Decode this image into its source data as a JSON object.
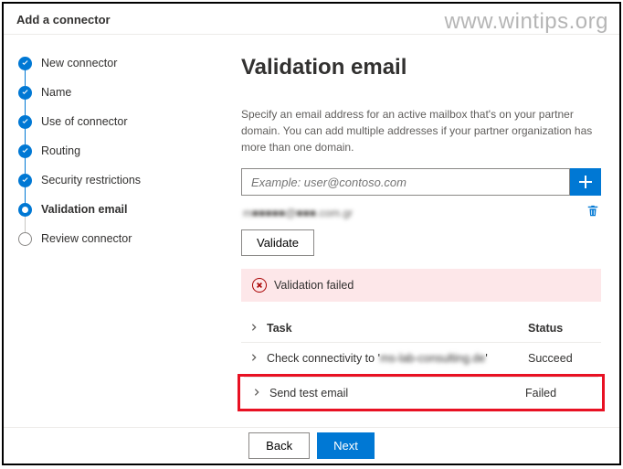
{
  "header": {
    "title": "Add a connector"
  },
  "watermark": "www.wintips.org",
  "steps": [
    {
      "label": "New connector",
      "state": "done"
    },
    {
      "label": "Name",
      "state": "done"
    },
    {
      "label": "Use of connector",
      "state": "done"
    },
    {
      "label": "Routing",
      "state": "done"
    },
    {
      "label": "Security restrictions",
      "state": "done"
    },
    {
      "label": "Validation email",
      "state": "current"
    },
    {
      "label": "Review connector",
      "state": "pending"
    }
  ],
  "main": {
    "title": "Validation email",
    "description": "Specify an email address for an active mailbox that's on your partner domain. You can add multiple addresses if your partner organization has more than one domain.",
    "input_placeholder": "Example: user@contoso.com",
    "added_email": "m■■■■■@■■■.com.gr",
    "validate_label": "Validate",
    "alert_text": "Validation failed",
    "table": {
      "col_task": "Task",
      "col_status": "Status",
      "rows": [
        {
          "task_prefix": "Check connectivity to '",
          "task_blur": "ms-lab-consulting.de",
          "task_suffix": "'",
          "status": "Succeed"
        },
        {
          "task_prefix": "Send test email",
          "task_blur": "",
          "task_suffix": "",
          "status": "Failed"
        }
      ]
    }
  },
  "footer": {
    "back": "Back",
    "next": "Next"
  }
}
